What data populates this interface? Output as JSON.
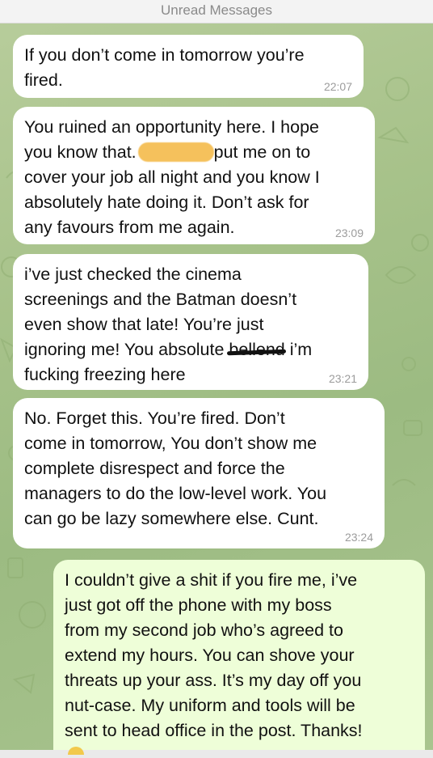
{
  "header": {
    "unread_label": "Unread Messages"
  },
  "messages": [
    {
      "direction": "incoming",
      "lines": [
        "If you don’t come in tomorrow you’re",
        "fired."
      ],
      "time": "22:07"
    },
    {
      "direction": "incoming",
      "line1": "You ruined an opportunity here. I hope",
      "line2_before": "you know that.",
      "line2_after": "put me on to",
      "lines_rest": [
        "cover your job all night and you know I",
        "absolutely hate doing it. Don’t ask for",
        "any favours from me again."
      ],
      "time": "23:09"
    },
    {
      "direction": "incoming",
      "lines_before": [
        "i’ve just checked the cinema",
        "screenings and the Batman doesn’t",
        "even show that late! You’re just"
      ],
      "line4_before": "ignoring me! You absolute ",
      "line4_struck": "bellend",
      "line4_after": " i’m",
      "line5": "fucking freezing here",
      "time": "23:21"
    },
    {
      "direction": "incoming",
      "lines": [
        "No. Forget this. You’re fired. Don’t",
        "come in tomorrow, You don’t show me",
        "complete disrespect and force the",
        "managers to do the low-level work. You",
        "can go be lazy somewhere else. Cunt."
      ],
      "time": "23:24"
    },
    {
      "direction": "outgoing",
      "lines": [
        "I couldn’t give a shit if you fire me, i’ve",
        "just got off the phone with my boss",
        "from my second job who’s agreed to",
        "extend my hours. You can shove your",
        "threats up your ass. It’s my day off you",
        "nut-case. My uniform and tools will be",
        "sent to head office in the post. Thanks!"
      ]
    }
  ],
  "colors": {
    "background": "#a7c28a",
    "incoming_bubble": "#ffffff",
    "outgoing_bubble": "#eefed8",
    "redaction": "#f5c15c",
    "timestamp": "#9c9c9c"
  }
}
